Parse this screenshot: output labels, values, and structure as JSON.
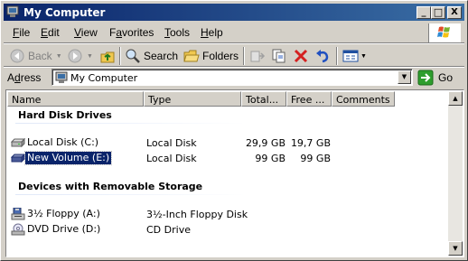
{
  "window": {
    "title": "My Computer",
    "controls": {
      "minimize": "_",
      "maximize": "□",
      "close": "X"
    }
  },
  "menu": {
    "items": [
      {
        "accel": "F",
        "rest": "ile"
      },
      {
        "accel": "E",
        "rest": "dit"
      },
      {
        "accel": "V",
        "rest": "iew"
      },
      {
        "pre": "F",
        "accel": "a",
        "rest": "vorites"
      },
      {
        "accel": "T",
        "rest": "ools"
      },
      {
        "accel": "H",
        "rest": "elp"
      }
    ]
  },
  "toolbar": {
    "back": "Back",
    "search": "Search",
    "folders": "Folders"
  },
  "address": {
    "label_accel": "d",
    "label_pre": "A",
    "label_rest": "ress",
    "value": "My Computer",
    "go": "Go"
  },
  "columns": [
    "Name",
    "Type",
    "Total...",
    "Free ...",
    "Comments"
  ],
  "groups": [
    {
      "title": "Hard Disk Drives",
      "items": [
        {
          "name": "Local Disk (C:)",
          "type": "Local Disk",
          "total": "29,9 GB",
          "free": "19,7 GB",
          "icon": "hard-disk-icon"
        },
        {
          "name": "New Volume (E:)",
          "type": "Local Disk",
          "total": "99 GB",
          "free": "99 GB",
          "icon": "hard-disk-icon",
          "selected": true
        }
      ]
    },
    {
      "title": "Devices with Removable Storage",
      "items": [
        {
          "name": "3½ Floppy (A:)",
          "type": "3½-Inch Floppy Disk",
          "total": "",
          "free": "",
          "icon": "floppy-drive-icon"
        },
        {
          "name": "DVD Drive (D:)",
          "type": "CD Drive",
          "total": "",
          "free": "",
          "icon": "dvd-drive-icon"
        }
      ]
    }
  ],
  "colors": {
    "title_start": "#0a246a",
    "title_end": "#3a6ea5",
    "selection": "#0a246a",
    "face": "#d4d0c8"
  }
}
